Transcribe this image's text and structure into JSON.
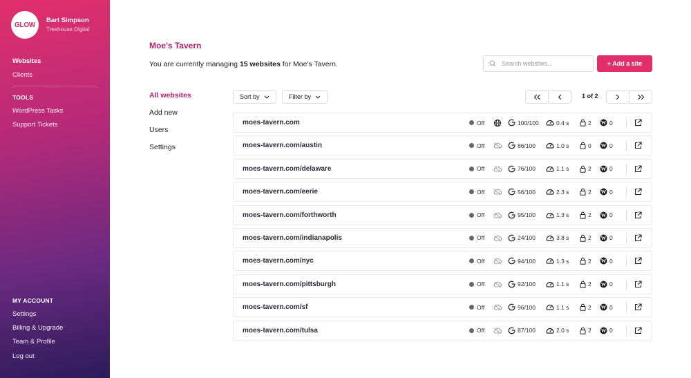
{
  "profile": {
    "logo_text": "GLOW",
    "name": "Bart Simpson",
    "org": "Treehouse Digital"
  },
  "sidebar": {
    "nav": [
      {
        "label": "Websites",
        "active": true
      },
      {
        "label": "Clients",
        "active": false
      }
    ],
    "tools_heading": "TOOLS",
    "tools": [
      {
        "label": "WordPress Tasks"
      },
      {
        "label": "Support Tickets"
      }
    ],
    "account_heading": "MY ACCOUNT",
    "account": [
      {
        "label": "Settings"
      },
      {
        "label": "Billing & Upgrade"
      },
      {
        "label": "Team & Profile"
      },
      {
        "label": "Log out"
      }
    ]
  },
  "header": {
    "title": "Moe's Tavern",
    "managing_prefix": "You are currently managing ",
    "managing_count": "15 websites",
    "managing_suffix": " for Moe's Tavern.",
    "search_placeholder": "Search websites...",
    "add_site_label": "+ Add a site"
  },
  "subnav": [
    {
      "label": "All websites",
      "active": true
    },
    {
      "label": "Add new",
      "active": false
    },
    {
      "label": "Users",
      "active": false
    },
    {
      "label": "Settings",
      "active": false
    }
  ],
  "toolbar": {
    "sort_label": "Sort by",
    "filter_label": "Filter by",
    "page_label": "1 of 2"
  },
  "sites": [
    {
      "name": "moes-tavern.com",
      "status": "Off",
      "score": "100/100",
      "speed": "0.4 s",
      "locks": "2",
      "wp": "0",
      "cloud_icon": "globe-icon"
    },
    {
      "name": "moes-tavern.com/austin",
      "status": "Off",
      "score": "86/100",
      "speed": "1.0 s",
      "locks": "0",
      "wp": "0",
      "cloud_icon": "cloud-icon"
    },
    {
      "name": "moes-tavern.com/delaware",
      "status": "Off",
      "score": "76/100",
      "speed": "1.1 s",
      "locks": "2",
      "wp": "0",
      "cloud_icon": "cloud-icon"
    },
    {
      "name": "moes-tavern.com/eerie",
      "status": "Off",
      "score": "56/100",
      "speed": "2.3 s",
      "locks": "2",
      "wp": "0",
      "cloud_icon": "cloud-icon"
    },
    {
      "name": "moes-tavern.com/forthworth",
      "status": "Off",
      "score": "95/100",
      "speed": "1.3 s",
      "locks": "2",
      "wp": "0",
      "cloud_icon": "cloud-icon"
    },
    {
      "name": "moes-tavern.com/indianapolis",
      "status": "Off",
      "score": "24/100",
      "speed": "3.8 s",
      "locks": "2",
      "wp": "0",
      "cloud_icon": "cloud-icon"
    },
    {
      "name": "moes-tavern.com/nyc",
      "status": "Off",
      "score": "94/100",
      "speed": "1.3 s",
      "locks": "2",
      "wp": "0",
      "cloud_icon": "cloud-icon"
    },
    {
      "name": "moes-tavern.com/pittsburgh",
      "status": "Off",
      "score": "92/100",
      "speed": "1.1 s",
      "locks": "2",
      "wp": "0",
      "cloud_icon": "cloud-icon"
    },
    {
      "name": "moes-tavern.com/sf",
      "status": "Off",
      "score": "96/100",
      "speed": "1.1 s",
      "locks": "2",
      "wp": "0",
      "cloud_icon": "cloud-icon"
    },
    {
      "name": "moes-tavern.com/tulsa",
      "status": "Off",
      "score": "87/100",
      "speed": "2.0 s",
      "locks": "2",
      "wp": "0",
      "cloud_icon": "cloud-icon"
    }
  ],
  "colors": {
    "accent": "#e12f6b",
    "title": "#b3206a",
    "status_dot": "#66666f"
  }
}
